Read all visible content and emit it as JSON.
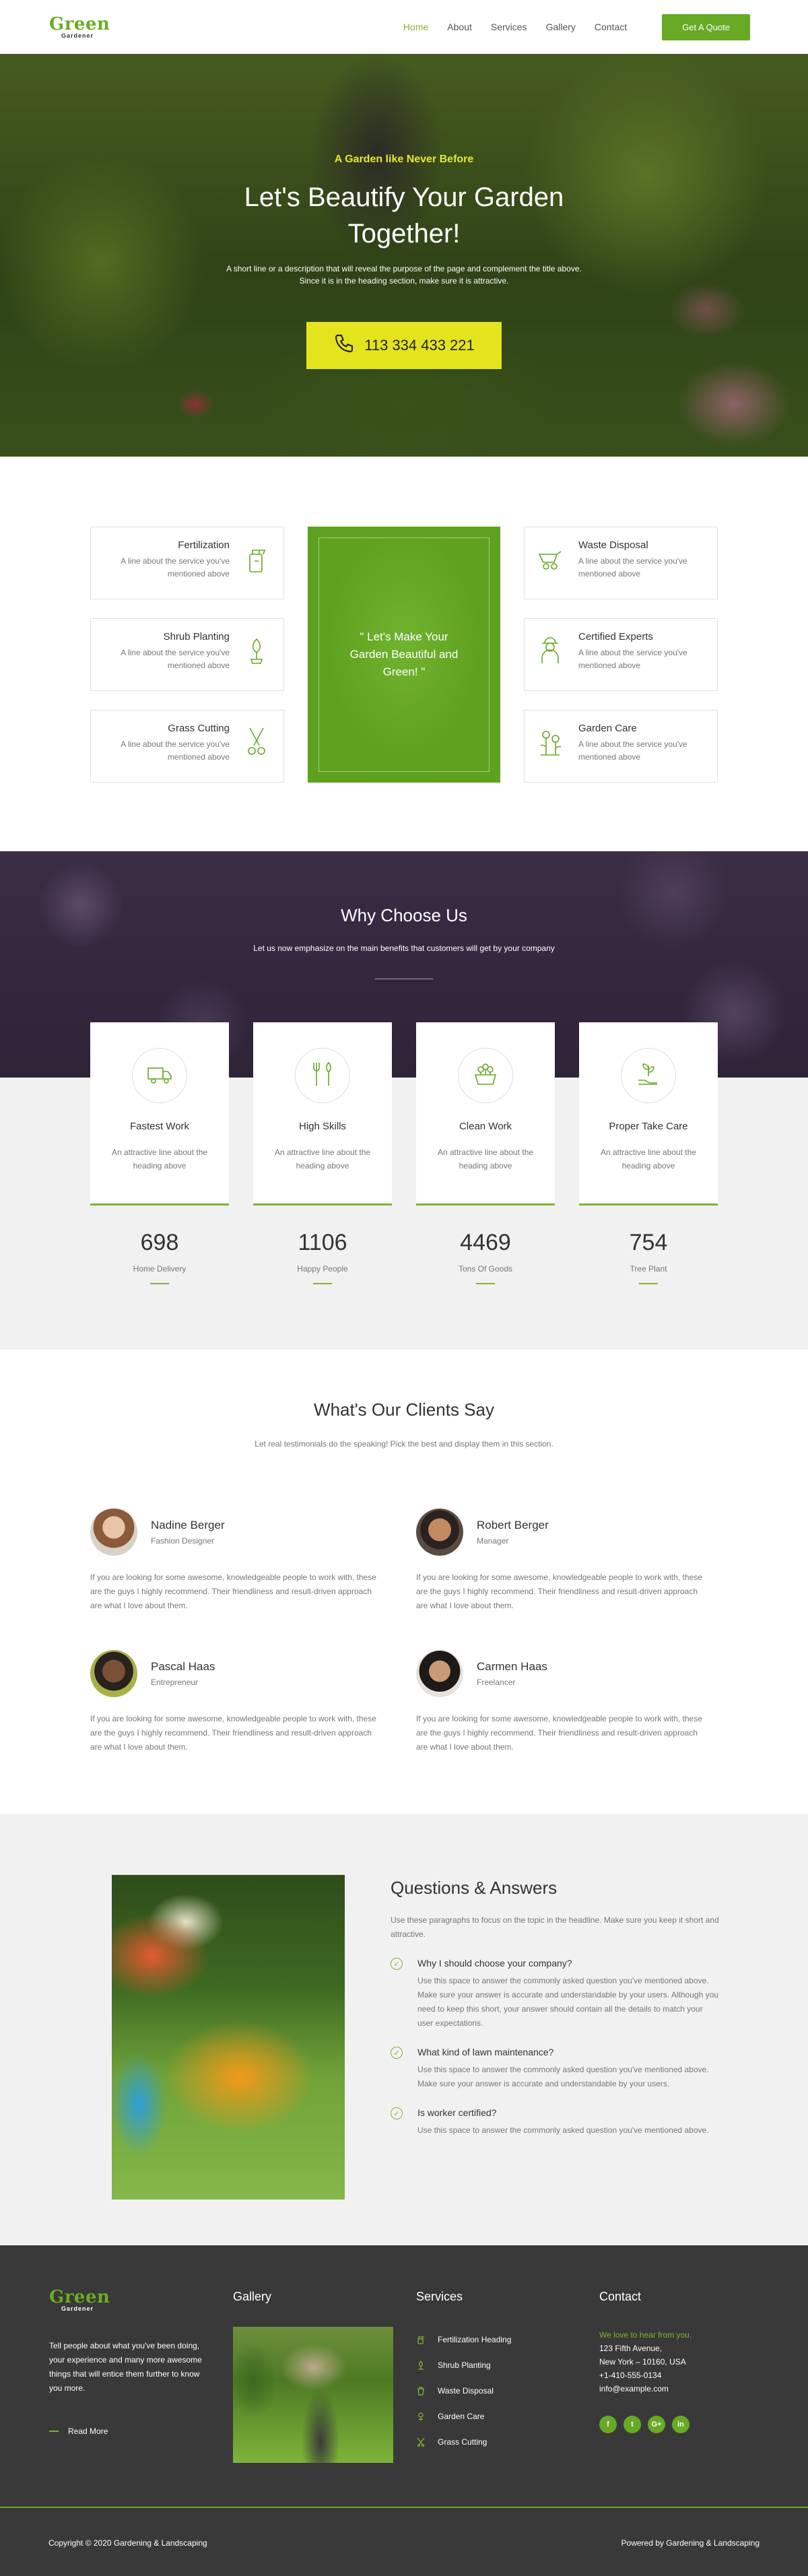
{
  "header": {
    "logo_top": "Green",
    "logo_bottom": "Gardener",
    "nav": [
      "Home",
      "About",
      "Services",
      "Gallery",
      "Contact"
    ],
    "cta": "Get A Quote",
    "accent": "#68a925"
  },
  "hero": {
    "tagline": "A Garden like Never Before",
    "title": "Let's Beautify Your Garden Together!",
    "desc_line1": "A short line or a description that will reveal the purpose of the page and complement the title above.",
    "desc_line2": "Since it is in the heading section, make sure it is attractive.",
    "phone": "113 334 433 221"
  },
  "services": {
    "center_quote": "\" Let's Make Your Garden Beautiful and Green! \"",
    "left": [
      {
        "title": "Fertilization",
        "desc": "A line about the service you've mentioned above",
        "icon": "spray-bottle-icon"
      },
      {
        "title": "Shrub Planting",
        "desc": "A line about the service you've mentioned above",
        "icon": "shrub-icon"
      },
      {
        "title": "Grass Cutting",
        "desc": "A line about the service you've mentioned above",
        "icon": "shears-icon"
      }
    ],
    "right": [
      {
        "title": "Waste Disposal",
        "desc": "A line about the service you've mentioned above",
        "icon": "wheelbarrow-icon"
      },
      {
        "title": "Certified Experts",
        "desc": "A line about the service you've mentioned above",
        "icon": "gardener-icon"
      },
      {
        "title": "Garden Care",
        "desc": "A line about the service you've mentioned above",
        "icon": "flowers-icon"
      }
    ]
  },
  "why": {
    "title": "Why Choose Us",
    "subtitle": "Let us now emphasize on the main benefits that customers will get by your company",
    "cards": [
      {
        "title": "Fastest Work",
        "desc": "An attractive line about the heading above",
        "icon": "truck-icon"
      },
      {
        "title": "High Skills",
        "desc": "An attractive line about the heading above",
        "icon": "tools-icon"
      },
      {
        "title": "Clean Work",
        "desc": "An attractive line about the heading above",
        "icon": "planter-icon"
      },
      {
        "title": "Proper Take Care",
        "desc": "An attractive line about the heading above",
        "icon": "plant-hand-icon"
      }
    ],
    "stats": [
      {
        "value": "698",
        "label": "Home Delivery"
      },
      {
        "value": "1106",
        "label": "Happy People"
      },
      {
        "value": "4469",
        "label": "Tons Of Goods"
      },
      {
        "value": "754",
        "label": "Tree Plant"
      }
    ]
  },
  "testimonials": {
    "title": "What's Our Clients Say",
    "subtitle": "Let real testimonials do the speaking! Pick the best and display them in this section.",
    "items": [
      {
        "name": "Nadine Berger",
        "role": "Fashion Designer",
        "quote": "If you are looking for some awesome, knowledgeable people to work with, these are the guys I highly recommend. Their friendliness and result-driven approach are what I love about them."
      },
      {
        "name": "Robert Berger",
        "role": "Manager",
        "quote": "If you are looking for some awesome, knowledgeable people to work with, these are the guys I highly recommend. Their friendliness and result-driven approach are what I love about them."
      },
      {
        "name": "Pascal Haas",
        "role": "Entrepreneur",
        "quote": "If you are looking for some awesome, knowledgeable people to work with, these are the guys I highly recommend. Their friendliness and result-driven approach are what I love about them."
      },
      {
        "name": "Carmen Haas",
        "role": "Freelancer",
        "quote": "If you are looking for some awesome, knowledgeable people to work with, these are the guys I highly recommend. Their friendliness and result-driven approach are what I love about them."
      }
    ]
  },
  "faq": {
    "title": "Questions & Answers",
    "intro": "Use these paragraphs to focus on the topic in the headline. Make sure you keep it short and attractive.",
    "items": [
      {
        "q": "Why I should choose your company?",
        "a": "Use this space to answer the commonly asked question you've mentioned above. Make sure your answer is accurate and understandable by your users. Although you need to keep this short, your answer should contain all the details to match your user expectations."
      },
      {
        "q": "What kind of lawn maintenance?",
        "a": "Use this space to answer the commonly asked question you've mentioned above. Make sure your answer is accurate and understandable by your users."
      },
      {
        "q": "Is worker certified?",
        "a": "Use this space to answer the commonly asked question you've mentioned above."
      }
    ]
  },
  "footer": {
    "about": "Tell people about what you've been doing, your experience and many more awesome things that will entice them further to know you more.",
    "read_more": "Read More",
    "gallery_title": "Gallery",
    "services_title": "Services",
    "services": [
      "Fertilization Heading",
      "Shrub Planting",
      "Waste Disposal",
      "Garden Care",
      "Grass Cutting"
    ],
    "contact_title": "Contact",
    "contact_tag": "We love to hear from you.",
    "address1": "123 Fifth Avenue,",
    "address2": "New York – 10160, USA",
    "phone": "+1-410-555-0134",
    "email": "info@example.com",
    "social": [
      "f",
      "t",
      "G+",
      "in"
    ],
    "copyright": "Copyright © 2020 Gardening & Landscaping",
    "powered": "Powered by Gardening & Landscaping"
  }
}
